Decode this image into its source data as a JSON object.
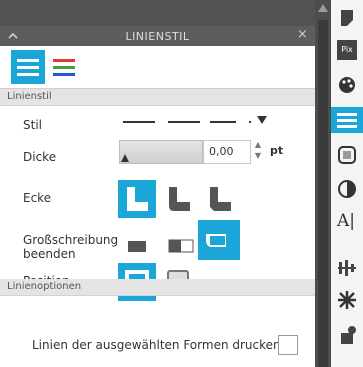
{
  "panel": {
    "title": "LINIENSTIL",
    "close_label": "×",
    "sections": {
      "linienstil": "Linienstil",
      "linienoptionen": "Linienoptionen"
    }
  },
  "fields": {
    "stil_label": "Stil",
    "dicke_label": "Dicke",
    "dicke_value": "0,00",
    "dicke_unit": "pt",
    "ecke_label": "Ecke",
    "caps_label_1": "Großschreibung",
    "caps_label_2": "beenden",
    "position_label": "Position",
    "print_lines_label": "Linien der ausgewählten Formen drucken"
  },
  "toolbar": {
    "icons": [
      "page-icon",
      "pixel-icon",
      "palette-icon",
      "line-style-icon",
      "fill-pattern-icon",
      "contrast-icon",
      "text-icon",
      "align-icon",
      "transform-icon",
      "page-flow-icon"
    ],
    "text_icon_label": "A|",
    "pixel_icon_label": "Pix"
  },
  "colors": {
    "accent": "#1aa6d6",
    "titlebar": "#5d5d5d",
    "section": "#e4e4e4"
  }
}
